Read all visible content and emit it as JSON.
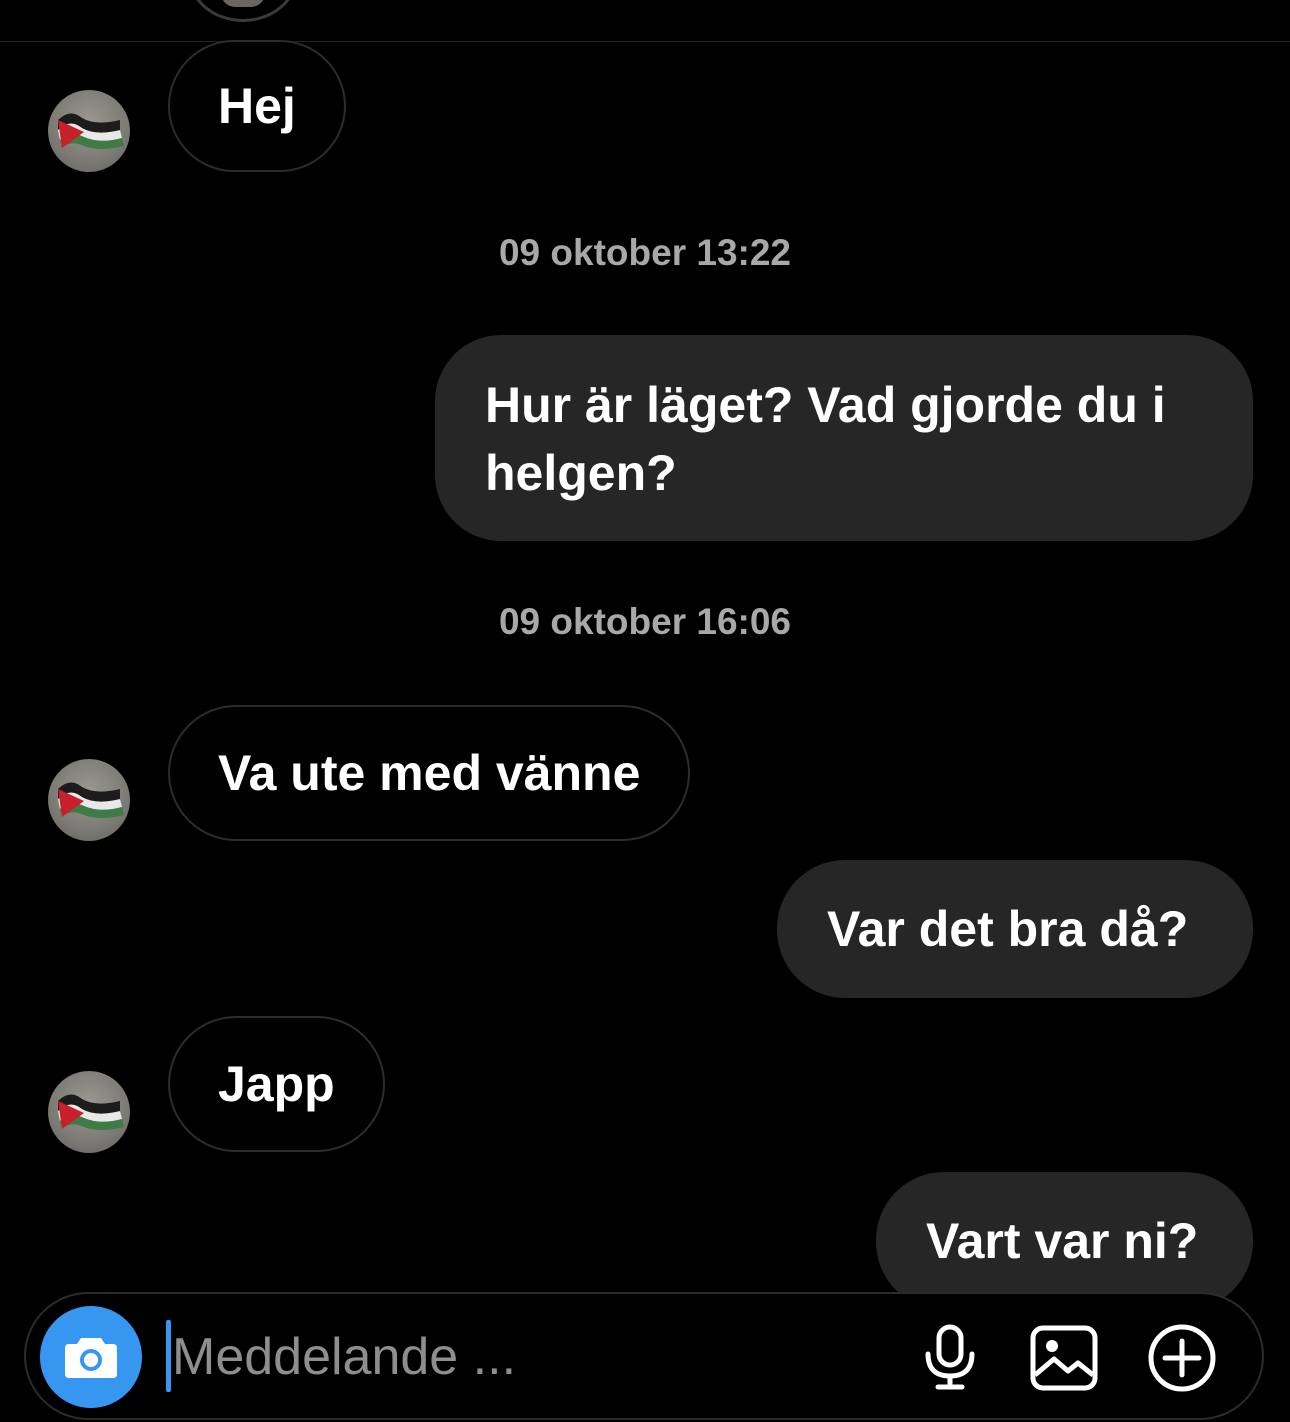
{
  "conversation": {
    "messages": [
      {
        "direction": "in",
        "text": "Hej"
      },
      {
        "direction": "timestamp",
        "text": "09 oktober 13:22"
      },
      {
        "direction": "out",
        "text": "Hur är läget? Vad gjorde du i helgen?"
      },
      {
        "direction": "timestamp",
        "text": "09 oktober 16:06"
      },
      {
        "direction": "in",
        "text": "Va ute med vänne"
      },
      {
        "direction": "out",
        "text": "Var det bra då?"
      },
      {
        "direction": "in",
        "text": "Japp"
      },
      {
        "direction": "out",
        "text": "Vart var ni?"
      }
    ]
  },
  "composer": {
    "placeholder": "Meddelande ...",
    "camera_icon": "camera-icon",
    "mic_icon": "microphone-icon",
    "gallery_icon": "image-icon",
    "plus_icon": "plus-circle-icon"
  },
  "colors": {
    "background": "#000000",
    "outgoing_bubble": "#262626",
    "incoming_border": "#2c2c2c",
    "timestamp": "#a8a8a8",
    "accent": "#3797f0"
  }
}
